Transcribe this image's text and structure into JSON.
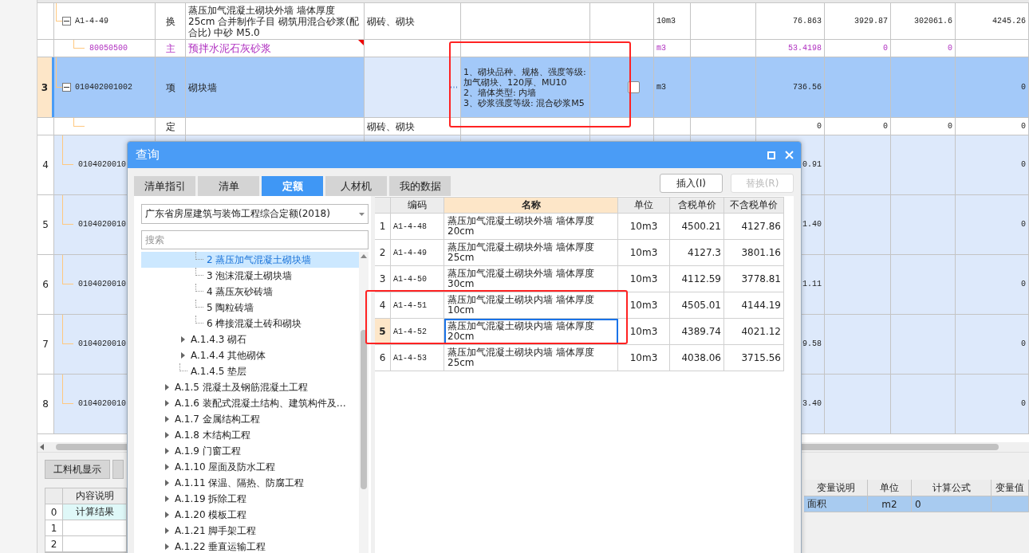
{
  "main_table": {
    "rows": [
      {
        "code": "A1-4-49",
        "type": "换",
        "name": "蒸压加气混凝土砌块外墙 墙体厚度 25cm 合并制作子目 砌筑用混合砂浆(配合比) 中砂 M5.0",
        "content": "砌砖、砌块",
        "unit": "10m3",
        "quantity": "76.863",
        "price": "3929.87",
        "total": "302061.6",
        "column_13": "4245.26",
        "kind": "quota",
        "selected": false,
        "expanded": true,
        "children": [
          {
            "code": "80050500",
            "type": "主",
            "name": "预拌水泥石灰砂浆",
            "note": true,
            "unit": "m3",
            "quantity": "53.4198",
            "price": "0",
            "total": "0",
            "kind": "material",
            "selected": false
          }
        ]
      },
      {
        "no": "3",
        "code": "010402001002",
        "type": "项",
        "name": "砌块墙",
        "features": [
          "1、砌块品种、规格、强度等级: 加气砌块、120厚、MU10",
          "2、墙体类型: 内墙",
          "3、砂浆强度等级: 混合砂浆M5"
        ],
        "checked": false,
        "unit": "m3",
        "quantity": "736.56",
        "column_13": "0",
        "kind": "item",
        "selected": true,
        "expanded": true,
        "children": [
          {
            "type": "定",
            "content": "砌砖、砌块",
            "quantity": "0",
            "price": "0",
            "total": "0",
            "column_13": "0",
            "kind": "quota",
            "selected": false
          }
        ]
      },
      {
        "no": "4",
        "code": "0104020010",
        "quantity": "0.91",
        "column_13": "0",
        "kind": "item",
        "selected": false
      },
      {
        "no": "5",
        "code": "0104020010",
        "quantity": "1.40",
        "column_13": "0",
        "kind": "item",
        "selected": false
      },
      {
        "no": "6",
        "code": "0104020010",
        "quantity": "1.11",
        "column_13": "0",
        "kind": "item",
        "selected": false
      },
      {
        "no": "7",
        "code": "0104020010",
        "quantity": "9.58",
        "column_13": "0",
        "kind": "item",
        "selected": false
      },
      {
        "no": "8",
        "code": "0104020010",
        "quantity": "3.40",
        "column_13": "0",
        "kind": "item",
        "selected": false
      }
    ]
  },
  "bottom_panel": {
    "tabs": [
      "工料机显示"
    ],
    "detail_grid": {
      "columns": [
        "内容说明"
      ],
      "rows": [
        {
          "no": "0",
          "text": "计算结果",
          "selected": true
        },
        {
          "no": "1",
          "selected": false
        },
        {
          "no": "2",
          "selected": false
        }
      ]
    },
    "variables": {
      "columns": [
        "变量说明",
        "单位",
        "计算公式",
        "变量值"
      ],
      "rows": [
        {
          "name": "面积",
          "unit": "m2",
          "formula": "0",
          "selected": true
        }
      ]
    }
  },
  "dialog": {
    "title": "查询",
    "tabs": [
      {
        "label": "清单指引",
        "selected": false
      },
      {
        "label": "清单",
        "selected": false
      },
      {
        "label": "定额",
        "selected": true
      },
      {
        "label": "人材机",
        "selected": false
      },
      {
        "label": "我的数据",
        "selected": false
      }
    ],
    "buttons": [
      {
        "label": "插入(I)",
        "disabled": false
      },
      {
        "label": "替换(R)",
        "disabled": true
      }
    ],
    "library": {
      "value": "广东省房屋建筑与装饰工程综合定额(2018)"
    },
    "search": {
      "placeholder": "搜索"
    },
    "tree": [
      {
        "children": [
          {
            "children": [
              {
                "label": "2 蒸压加气混凝土砌块墙",
                "kind": "leaf",
                "selected": true
              },
              {
                "label": "3 泡沫混凝土砌块墙",
                "kind": "leaf",
                "selected": false
              },
              {
                "label": "4 蒸压灰砂砖墙",
                "kind": "leaf",
                "selected": false
              },
              {
                "label": "5 陶粒砖墙",
                "kind": "leaf",
                "selected": false
              },
              {
                "label": "6 榫接混凝土砖和砌块",
                "kind": "leaf",
                "selected": false
              }
            ]
          },
          {
            "label": "A.1.4.3 砌石",
            "kind": "group",
            "expanded": false,
            "selected": false
          },
          {
            "label": "A.1.4.4 其他砌体",
            "kind": "group",
            "expanded": false,
            "selected": false
          },
          {
            "label": "A.1.4.5 垫层",
            "kind": "leaf",
            "selected": false
          }
        ]
      },
      {
        "label": "A.1.5 混凝土及钢筋混凝土工程",
        "kind": "group",
        "expanded": false,
        "selected": false
      },
      {
        "label": "A.1.6 装配式混凝土结构、建筑构件及…",
        "kind": "group",
        "expanded": false,
        "selected": false
      },
      {
        "label": "A.1.7 金属结构工程",
        "kind": "group",
        "expanded": false,
        "selected": false
      },
      {
        "label": "A.1.8 木结构工程",
        "kind": "group",
        "expanded": false,
        "selected": false
      },
      {
        "label": "A.1.9 门窗工程",
        "kind": "group",
        "expanded": false,
        "selected": false
      },
      {
        "label": "A.1.10 屋面及防水工程",
        "kind": "group",
        "expanded": false,
        "selected": false
      },
      {
        "label": "A.1.11 保温、隔热、防腐工程",
        "kind": "group",
        "expanded": false,
        "selected": false
      },
      {
        "label": "A.1.19 拆除工程",
        "kind": "group",
        "expanded": false,
        "selected": false
      },
      {
        "label": "A.1.20 模板工程",
        "kind": "group",
        "expanded": false,
        "selected": false
      },
      {
        "label": "A.1.21 脚手架工程",
        "kind": "group",
        "expanded": false,
        "selected": false
      },
      {
        "label": "A.1.22 垂直运输工程",
        "kind": "group",
        "expanded": false,
        "selected": false
      }
    ],
    "grid": {
      "columns": [
        {
          "label": "编码",
          "selected": false
        },
        {
          "label": "名称",
          "selected": true
        },
        {
          "label": "单位",
          "selected": false
        },
        {
          "label": "含税单价",
          "selected": false
        },
        {
          "label": "不含税单价",
          "selected": false
        }
      ],
      "rows": [
        {
          "no": "1",
          "code": "A1-4-48",
          "name": "蒸压加气混凝土砌块外墙 墙体厚度 20cm",
          "unit": "10m3",
          "price_with_tax": "4500.21",
          "price_without_tax": "4127.86",
          "selected": false
        },
        {
          "no": "2",
          "code": "A1-4-49",
          "name": "蒸压加气混凝土砌块外墙 墙体厚度 25cm",
          "unit": "10m3",
          "price_with_tax": "4127.3",
          "price_without_tax": "3801.16",
          "selected": false
        },
        {
          "no": "3",
          "code": "A1-4-50",
          "name": "蒸压加气混凝土砌块外墙 墙体厚度 30cm",
          "unit": "10m3",
          "price_with_tax": "4112.59",
          "price_without_tax": "3778.81",
          "selected": false
        },
        {
          "no": "4",
          "code": "A1-4-51",
          "name": "蒸压加气混凝土砌块内墙 墙体厚度 10cm",
          "unit": "10m3",
          "price_with_tax": "4505.01",
          "price_without_tax": "4144.19",
          "selected": false
        },
        {
          "no": "5",
          "code": "A1-4-52",
          "name": "蒸压加气混凝土砌块内墙 墙体厚度 20cm",
          "unit": "10m3",
          "price_with_tax": "4389.74",
          "price_without_tax": "4021.12",
          "selected": true
        },
        {
          "no": "6",
          "code": "A1-4-53",
          "name": "蒸压加气混凝土砌块内墙 墙体厚度 25cm",
          "unit": "10m3",
          "price_with_tax": "4038.06",
          "price_without_tax": "3715.56",
          "selected": false
        }
      ]
    }
  },
  "annotations": [
    {
      "kind": "rectangle"
    },
    {
      "kind": "rectangle"
    }
  ]
}
